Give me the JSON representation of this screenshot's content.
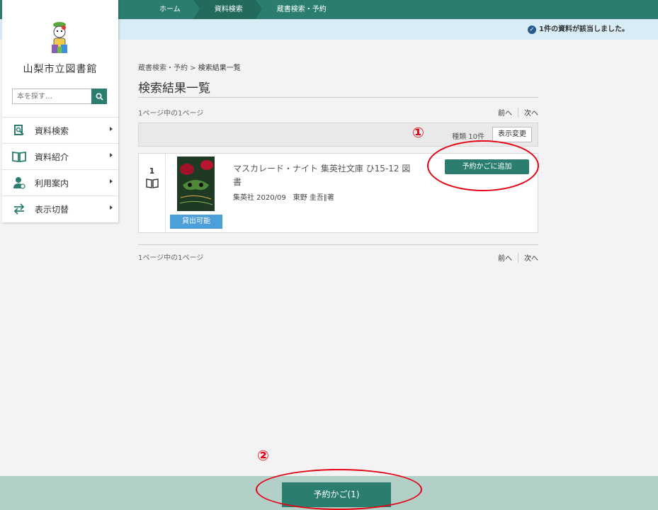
{
  "breadcrumb_nav": {
    "items": [
      {
        "label": "ホーム"
      },
      {
        "label": "資料検索"
      },
      {
        "label": "蔵書検索・予約"
      }
    ]
  },
  "notice": {
    "text": "1件の資料が該当しました。"
  },
  "sidebar": {
    "library_name": "山梨市立図書館",
    "search_placeholder": "本を探す…",
    "menu": [
      {
        "label": "資料検索",
        "icon": "search-book-icon"
      },
      {
        "label": "資料紹介",
        "icon": "open-book-icon"
      },
      {
        "label": "利用案内",
        "icon": "user-guide-icon"
      },
      {
        "label": "表示切替",
        "icon": "switch-arrows-icon"
      }
    ]
  },
  "main": {
    "breadcrumb": {
      "parent": "蔵書検索・予約",
      "separator": " > ",
      "current": "検索結果一覧"
    },
    "title": "検索結果一覧",
    "page_info_top": "1ページ中の1ページ",
    "page_info_bottom": "1ページ中の1ページ",
    "pager": {
      "prev": "前へ",
      "next": "次へ"
    },
    "toolbar": {
      "kind_label": "種類 10件",
      "view_change": "表示変更"
    },
    "results": [
      {
        "number": "1",
        "title": "マスカレード・ナイト 集英社文庫 ひ15-12 図書",
        "meta": "集英社 2020/09　東野 圭吾∥著",
        "availability": "貸出可能",
        "action": "予約かごに追加"
      }
    ]
  },
  "annotations": {
    "marker1": "①",
    "marker2": "②"
  },
  "cart": {
    "label": "予約かご(1)"
  },
  "colors": {
    "primary": "#2b7e6f",
    "notice_bg": "#d7ecf5",
    "available": "#4c9fd8",
    "annotation": "#e60012",
    "bottom_bar": "#b2d0c8"
  }
}
